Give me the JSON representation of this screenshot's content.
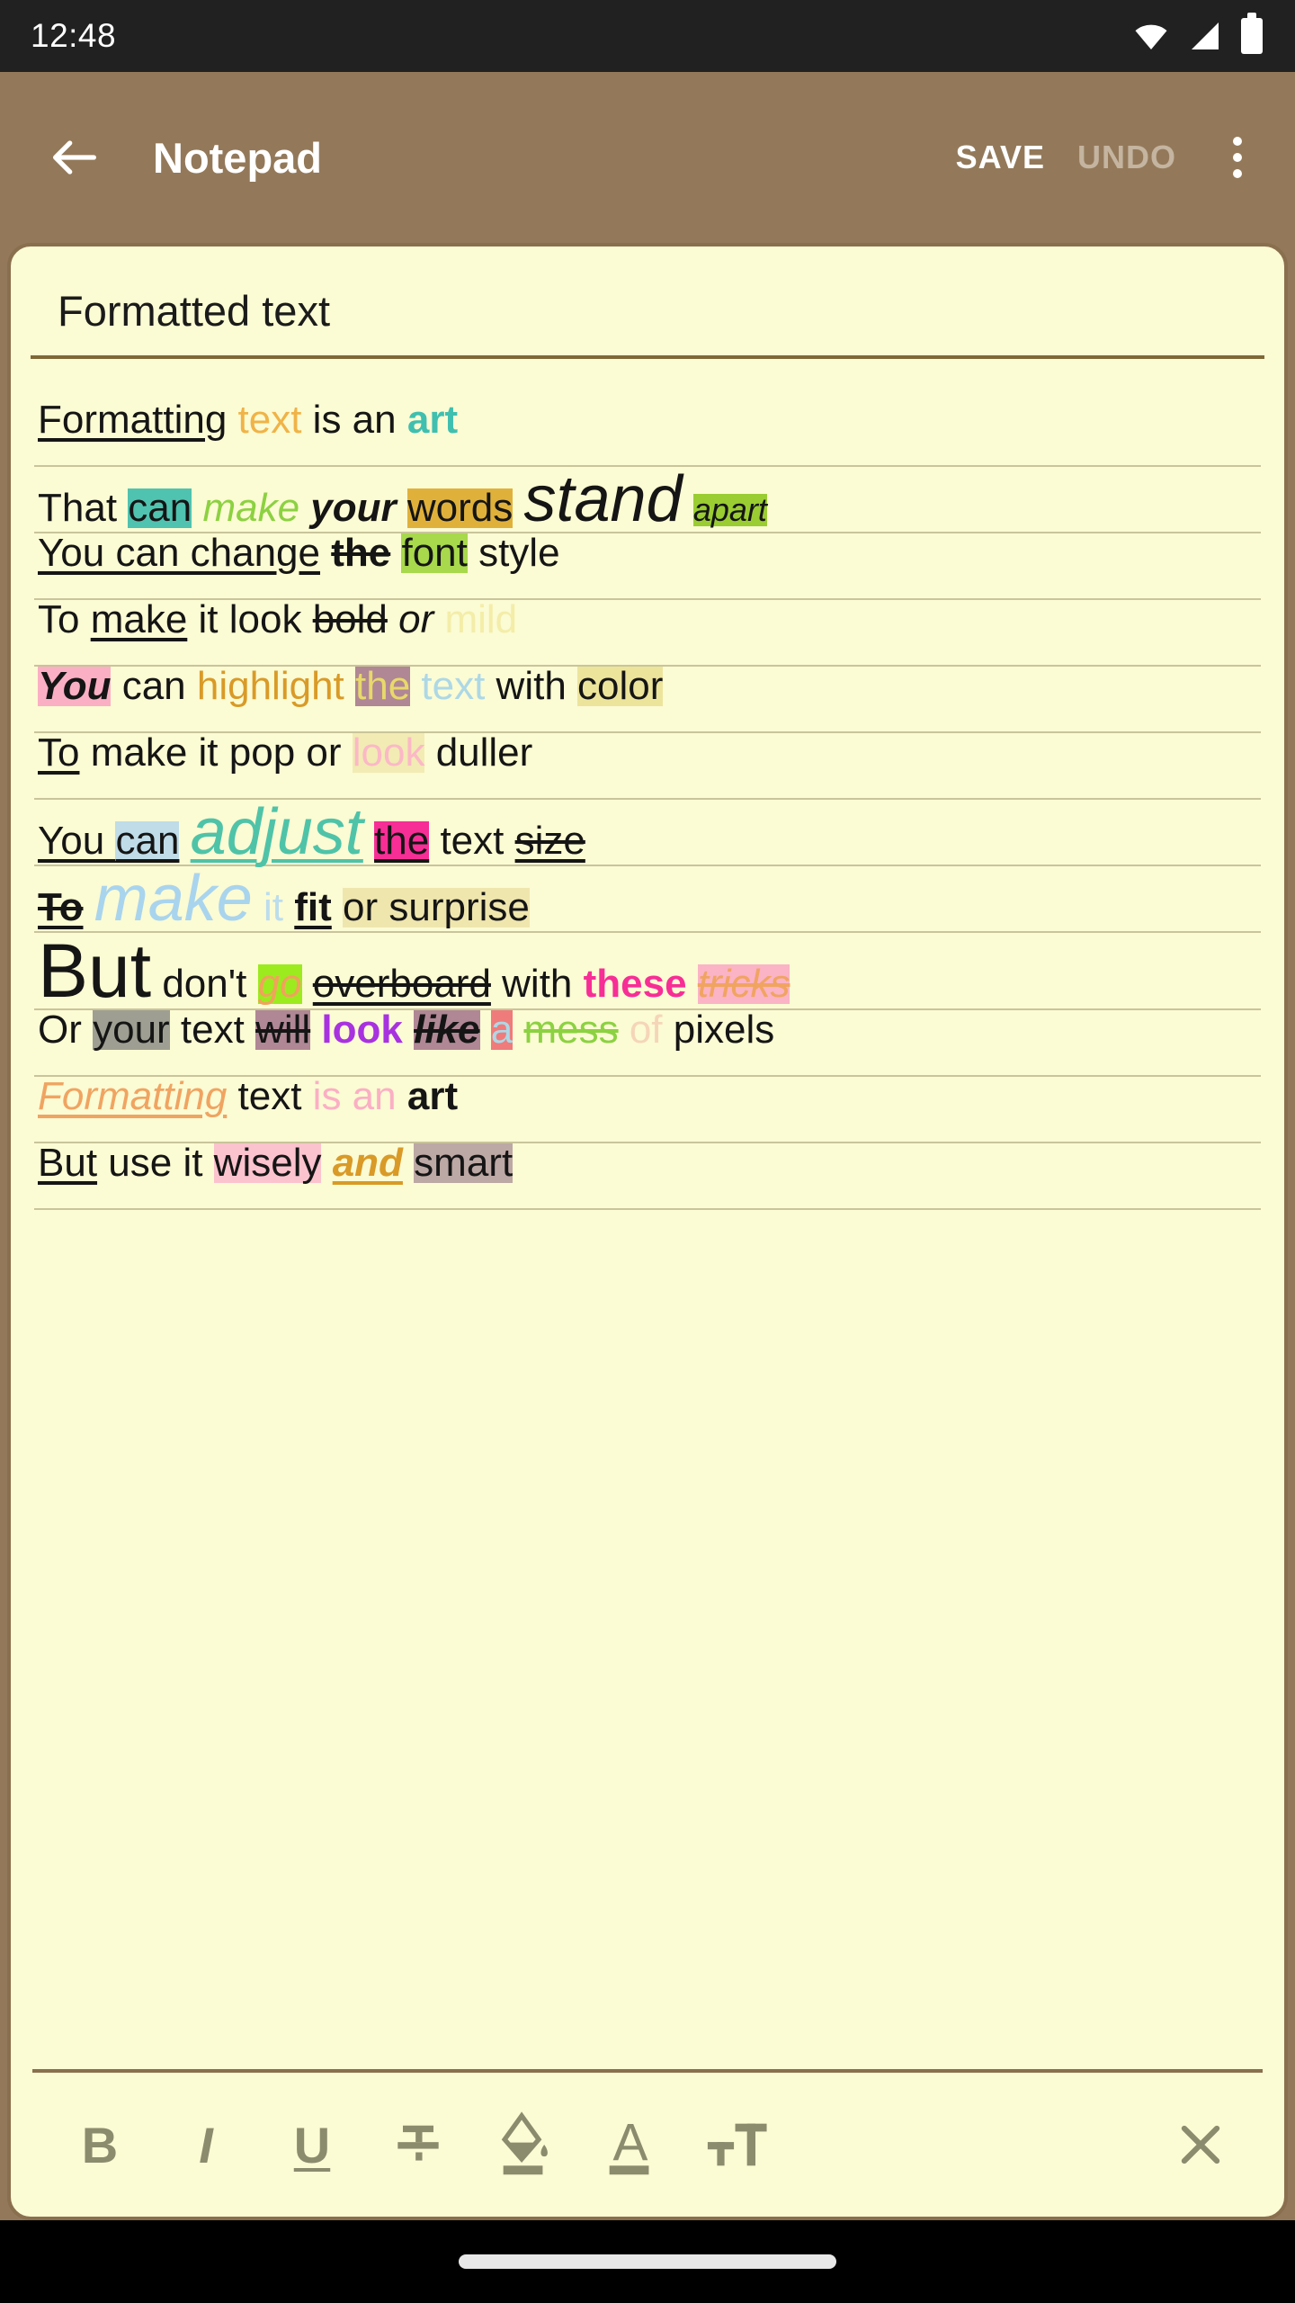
{
  "status_bar": {
    "clock": "12:48",
    "icons": [
      "wifi-icon",
      "signal-icon",
      "battery-icon"
    ]
  },
  "app_bar": {
    "back_icon": "back-arrow-icon",
    "title": "Notepad",
    "save_label": "SAVE",
    "undo_label": "UNDO",
    "overflow_icon": "overflow-menu-icon"
  },
  "note": {
    "title": "Formatted text",
    "lines": [
      {
        "id": "line-1",
        "runs": [
          {
            "text": "Formatting",
            "classes": "u"
          },
          {
            "text": " "
          },
          {
            "text": "text",
            "color": "#F0B347"
          },
          {
            "text": " is an "
          },
          {
            "text": "art",
            "classes": "b",
            "color": "#3FBFAF"
          }
        ]
      },
      {
        "id": "line-2",
        "runs": [
          {
            "text": "That "
          },
          {
            "text": "can",
            "bg": "#4FC3B0"
          },
          {
            "text": " "
          },
          {
            "text": "make",
            "classes": "i",
            "color": "#8CD141"
          },
          {
            "text": " "
          },
          {
            "text": "your",
            "classes": "b i"
          },
          {
            "text": " "
          },
          {
            "text": "words",
            "bg": "#E0B13A"
          },
          {
            "text": " "
          },
          {
            "text": "stand",
            "classes": "i big"
          },
          {
            "text": " "
          },
          {
            "text": "apart",
            "classes": "i sm",
            "bg": "#9ACD32"
          }
        ]
      },
      {
        "id": "line-3",
        "runs": [
          {
            "text": "You can change",
            "classes": "u"
          },
          {
            "text": " "
          },
          {
            "text": "the",
            "classes": "b s"
          },
          {
            "text": " "
          },
          {
            "text": "font",
            "bg": "#A8D84C"
          },
          {
            "text": " style"
          }
        ]
      },
      {
        "id": "line-4",
        "runs": [
          {
            "text": "To "
          },
          {
            "text": "make",
            "classes": "u"
          },
          {
            "text": " it look "
          },
          {
            "text": "bold",
            "classes": "s"
          },
          {
            "text": " "
          },
          {
            "text": "or",
            "classes": "i"
          },
          {
            "text": " "
          },
          {
            "text": "mild",
            "color": "#F3EDA8"
          }
        ]
      },
      {
        "id": "line-5",
        "runs": [
          {
            "text": "You",
            "classes": "b i",
            "bg": "#FBAFC4"
          },
          {
            "text": " can "
          },
          {
            "text": "highlight",
            "color": "#D99A27"
          },
          {
            "text": " "
          },
          {
            "text": "the",
            "color": "#E8D96A",
            "bg": "#B08795"
          },
          {
            "text": " "
          },
          {
            "text": "text",
            "color": "#ADD8E6"
          },
          {
            "text": " with "
          },
          {
            "text": "color",
            "bg": "#EDE49C"
          }
        ]
      },
      {
        "id": "line-6",
        "runs": [
          {
            "text": "To",
            "classes": "u"
          },
          {
            "text": " make it pop or "
          },
          {
            "text": "look",
            "color": "#FBB8C6",
            "bg": "#F2EBB4"
          },
          {
            "text": " duller"
          }
        ]
      },
      {
        "id": "line-7",
        "runs": [
          {
            "text": "You ",
            "classes": "u"
          },
          {
            "text": "can",
            "classes": "u",
            "bg": "#BFDCE8"
          },
          {
            "text": " "
          },
          {
            "text": "adjust",
            "classes": "i u big",
            "color": "#4FC3A8"
          },
          {
            "text": " "
          },
          {
            "text": "the",
            "classes": "u",
            "bg": "#F72E96"
          },
          {
            "text": " text "
          },
          {
            "text": "size",
            "classes": "su"
          }
        ]
      },
      {
        "id": "line-8",
        "runs": [
          {
            "text": "To",
            "classes": "b su"
          },
          {
            "text": " "
          },
          {
            "text": "make",
            "classes": "i big",
            "color": "#A9D4EE"
          },
          {
            "text": " "
          },
          {
            "text": "it",
            "color": "#BBDDEE"
          },
          {
            "text": " "
          },
          {
            "text": "fit",
            "classes": "b u"
          },
          {
            "text": " "
          },
          {
            "text": "or surprise",
            "bg": "#EFE6AE"
          }
        ]
      },
      {
        "id": "line-9",
        "runs": [
          {
            "text": "But",
            "classes": "big2"
          },
          {
            "text": " don't "
          },
          {
            "text": "go",
            "classes": "i",
            "color": "#F2A25C",
            "bg": "#9BEB1E"
          },
          {
            "text": " "
          },
          {
            "text": "overboard",
            "classes": "su"
          },
          {
            "text": " with "
          },
          {
            "text": "these",
            "classes": "b",
            "color": "#F72E96"
          },
          {
            "text": " "
          },
          {
            "text": "tricks",
            "classes": "i s",
            "color": "#F0A461",
            "bg": "#FBB3C6"
          }
        ]
      },
      {
        "id": "line-10",
        "runs": [
          {
            "text": "Or "
          },
          {
            "text": "your",
            "bg": "#9E9E92"
          },
          {
            "text": " text "
          },
          {
            "text": "will",
            "classes": "s",
            "bg": "#B08795"
          },
          {
            "text": " "
          },
          {
            "text": "look",
            "classes": "b",
            "color": "#A832E0"
          },
          {
            "text": " "
          },
          {
            "text": "like",
            "classes": "b i s",
            "bg": "#B08795"
          },
          {
            "text": " "
          },
          {
            "text": "a",
            "color": "#ADD8E6",
            "bg": "#EF7B7B"
          },
          {
            "text": " "
          },
          {
            "text": "mess",
            "classes": "s",
            "color": "#8CD141"
          },
          {
            "text": " "
          },
          {
            "text": "of",
            "color": "#F5D5B8"
          },
          {
            "text": " pixels"
          }
        ]
      },
      {
        "id": "line-11",
        "runs": [
          {
            "text": "Formatting",
            "classes": "i u",
            "color": "#F0A461"
          },
          {
            "text": " text "
          },
          {
            "text": "is an",
            "color": "#FBAFC4"
          },
          {
            "text": " "
          },
          {
            "text": "art",
            "classes": "b"
          }
        ]
      },
      {
        "id": "line-12",
        "runs": [
          {
            "text": "But",
            "classes": "u"
          },
          {
            "text": " use it "
          },
          {
            "text": "wisely",
            "bg": "#FBC3CE"
          },
          {
            "text": " "
          },
          {
            "text": "and",
            "classes": "b i u",
            "color": "#D99A27"
          },
          {
            "text": " "
          },
          {
            "text": "smart",
            "bg": "#BCA8A4"
          }
        ]
      }
    ]
  },
  "toolbar": {
    "buttons": [
      {
        "name": "bold-icon",
        "label": "B"
      },
      {
        "name": "italic-icon",
        "label": "I"
      },
      {
        "name": "underline-icon",
        "label": "U"
      },
      {
        "name": "strikethrough-icon",
        "label": "S"
      },
      {
        "name": "highlight-fill-icon",
        "label": ""
      },
      {
        "name": "text-color-icon",
        "label": "A"
      },
      {
        "name": "font-size-icon",
        "label": "T"
      }
    ],
    "close_icon": "close-icon"
  },
  "nav_bar": {
    "home_indicator": "home-indicator"
  },
  "colors": {
    "app_bar_bg": "#93795A",
    "note_bg": "#FBFBD4",
    "note_border": "#8A6F4E",
    "status_bar_bg": "#212121",
    "toolbar_icon": "#8b8b6e",
    "rule_line": "#c9c49a"
  }
}
